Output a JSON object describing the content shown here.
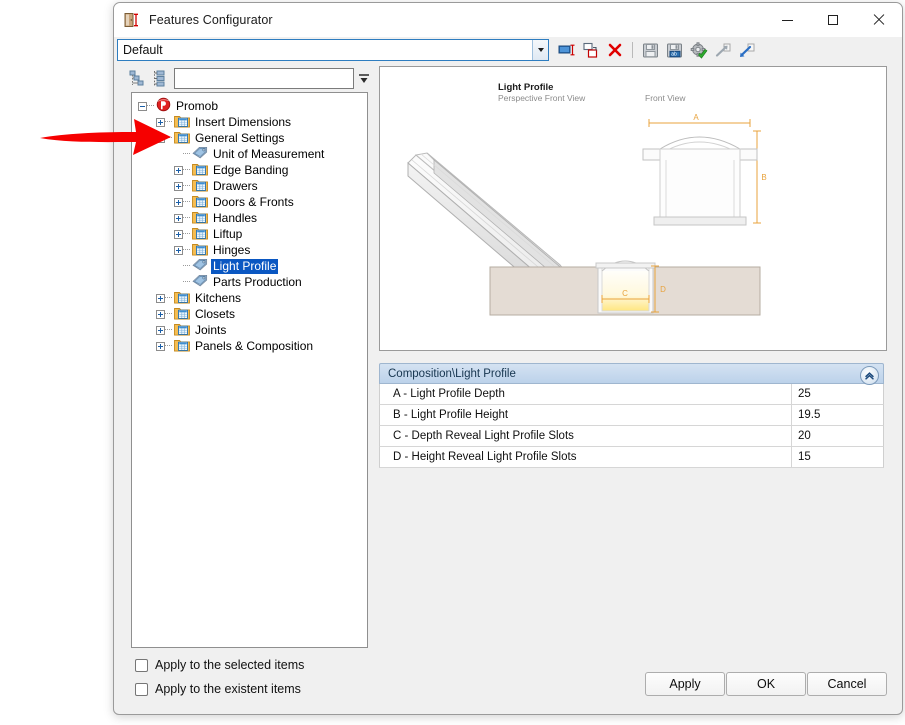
{
  "window": {
    "title": "Features Configurator",
    "app_icon": "cabinet-dimension-icon",
    "minimize_label": "Minimize",
    "maximize_label": "Maximize",
    "close_label": "Close"
  },
  "profile": {
    "value": "Default",
    "dropdown_icon": "chevron-down-icon"
  },
  "toolbar": {
    "items": [
      {
        "name": "rename-item",
        "icon": "rename-icon"
      },
      {
        "name": "duplicate-item",
        "icon": "copy-icon"
      },
      {
        "name": "delete-item",
        "icon": "red-x-icon"
      },
      {
        "name": "save",
        "icon": "floppy-disk-icon"
      },
      {
        "name": "save-as",
        "icon": "save-as-icon"
      },
      {
        "name": "apply-validate",
        "icon": "gear-check-icon"
      },
      {
        "name": "import",
        "icon": "import-arrow-icon"
      },
      {
        "name": "export",
        "icon": "export-arrow-icon"
      }
    ]
  },
  "tree_tools": {
    "collapse_all_icon": "collapse-tree-icon",
    "expand_all_icon": "expand-tree-icon",
    "search_value": "",
    "search_placeholder": "",
    "search_dropdown_icon": "filter-dropdown-icon"
  },
  "tree": {
    "nodes": [
      {
        "label": "Promob",
        "depth": 0,
        "icon": "promob-logo-icon",
        "expander": "minus",
        "selected": false
      },
      {
        "label": "Insert Dimensions",
        "depth": 1,
        "icon": "folder-table-icon",
        "expander": "plus",
        "selected": false
      },
      {
        "label": "General Settings",
        "depth": 1,
        "icon": "folder-table-icon",
        "expander": "minus",
        "selected": false
      },
      {
        "label": "Unit of Measurement",
        "depth": 2,
        "icon": "tag-icon",
        "expander": "none",
        "selected": false
      },
      {
        "label": "Edge Banding",
        "depth": 2,
        "icon": "folder-table-icon",
        "expander": "plus",
        "selected": false
      },
      {
        "label": "Drawers",
        "depth": 2,
        "icon": "folder-table-icon",
        "expander": "plus",
        "selected": false
      },
      {
        "label": "Doors & Fronts",
        "depth": 2,
        "icon": "folder-table-icon",
        "expander": "plus",
        "selected": false
      },
      {
        "label": "Handles",
        "depth": 2,
        "icon": "folder-table-icon",
        "expander": "plus",
        "selected": false
      },
      {
        "label": "Liftup",
        "depth": 2,
        "icon": "folder-table-icon",
        "expander": "plus",
        "selected": false
      },
      {
        "label": "Hinges",
        "depth": 2,
        "icon": "folder-table-icon",
        "expander": "plus",
        "selected": false
      },
      {
        "label": "Light Profile",
        "depth": 2,
        "icon": "tag-icon",
        "expander": "none",
        "selected": true
      },
      {
        "label": "Parts Production",
        "depth": 2,
        "icon": "tag-icon",
        "expander": "none",
        "selected": false
      },
      {
        "label": "Kitchens",
        "depth": 1,
        "icon": "folder-table-icon",
        "expander": "plus",
        "selected": false
      },
      {
        "label": "Closets",
        "depth": 1,
        "icon": "folder-table-icon",
        "expander": "plus",
        "selected": false
      },
      {
        "label": "Joints",
        "depth": 1,
        "icon": "folder-table-icon",
        "expander": "plus",
        "selected": false
      },
      {
        "label": "Panels & Composition",
        "depth": 1,
        "icon": "folder-table-icon",
        "expander": "plus",
        "selected": false
      }
    ]
  },
  "preview": {
    "title": "Light Profile",
    "subtitle": "Perspective Front View",
    "second_view_label": "Front View",
    "dimension_labels": {
      "a": "A",
      "b": "B",
      "c": "C",
      "d": "D"
    }
  },
  "properties": {
    "header": "Composition\\Light Profile",
    "collapse_icon": "chevron-up-icon",
    "rows": [
      {
        "name": "A - Light Profile Depth",
        "value": "25"
      },
      {
        "name": "B - Light Profile Height",
        "value": "19.5"
      },
      {
        "name": "C - Depth Reveal Light Profile Slots",
        "value": "20"
      },
      {
        "name": "D - Height Reveal Light Profile Slots",
        "value": "15"
      }
    ]
  },
  "options": {
    "apply_selected": "Apply to the selected items",
    "apply_existent": "Apply to the existent items"
  },
  "buttons": {
    "apply": "Apply",
    "ok": "OK",
    "cancel": "Cancel"
  },
  "annotation": {
    "arrow_color": "#f60000",
    "arrow_target": "General Settings"
  },
  "colors": {
    "selection_blue": "#0a57c2",
    "combo_border": "#2e7dc0",
    "props_header": "#bcd2ea",
    "dimension_orange": "#e8a33d"
  }
}
